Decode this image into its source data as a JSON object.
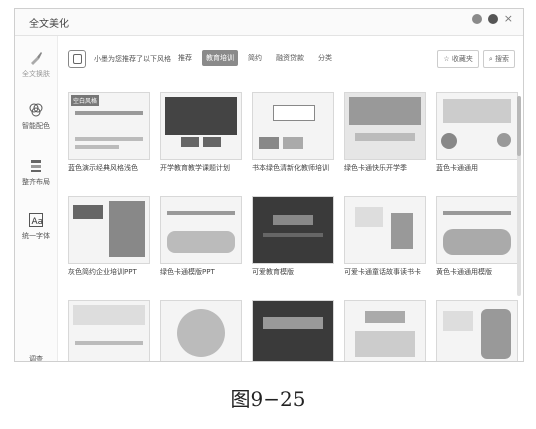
{
  "window": {
    "title": "全文美化"
  },
  "sidebar": {
    "items": [
      {
        "label": "全文换肤",
        "icon": "brush-icon"
      },
      {
        "label": "智能配色",
        "icon": "palette-icon"
      },
      {
        "label": "整齐布局",
        "icon": "layout-icon"
      },
      {
        "label": "统一字体",
        "icon": "font-icon"
      }
    ],
    "footer_label": "调查"
  },
  "toolbar": {
    "prompt": "小墨为您推荐了以下风格",
    "filters": [
      "推荐",
      "教育培训",
      "简约",
      "融资贷款",
      "分类"
    ],
    "selected_filter": "教育培训",
    "favorites": "☆ 收藏夹",
    "search": "搜索"
  },
  "cards": [
    {
      "caption": "蓝色演示经典风格浅色",
      "badge": "空白风格"
    },
    {
      "caption": "开学教育教学课题计划"
    },
    {
      "caption": "书本绿色清新化教师培训"
    },
    {
      "caption": "绿色卡通快乐开学季"
    },
    {
      "caption": "蓝色卡通通用"
    },
    {
      "caption": "灰色简约企业培训PPT"
    },
    {
      "caption": "绿色卡通模版PPT"
    },
    {
      "caption": "可爱教育模版"
    },
    {
      "caption": "可爱卡通童话故事读书卡"
    },
    {
      "caption": "黄色卡通通用模版"
    },
    {
      "caption": ""
    },
    {
      "caption": ""
    },
    {
      "caption": ""
    },
    {
      "caption": ""
    },
    {
      "caption": ""
    }
  ],
  "figure_caption": "图9−25"
}
